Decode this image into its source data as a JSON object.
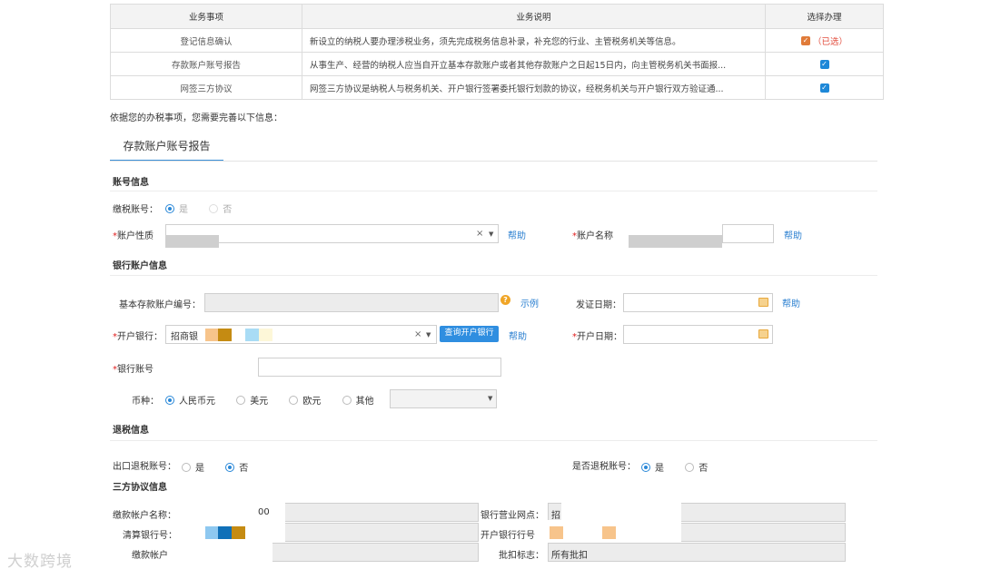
{
  "business_table": {
    "headers": [
      "业务事项",
      "业务说明",
      "选择办理"
    ],
    "rows": [
      {
        "item": "登记信息确认",
        "desc": "新设立的纳税人要办理涉税业务，须先完成税务信息补录，补充您的行业、主管税务机关等信息。",
        "selected_label": "（已选）"
      },
      {
        "item": "存款账户账号报告",
        "desc": "从事生产、经营的纳税人应当自开立基本存款账户或者其他存款账户之日起15日内，向主管税务机关书面报..."
      },
      {
        "item": "网签三方协议",
        "desc": "网签三方协议是纳税人与税务机关、开户银行签署委托银行划款的协议，经税务机关与开户银行双方验证通..."
      }
    ]
  },
  "intro_text": "依据您的办税事项，您需要完善以下信息：",
  "tab": {
    "label": "存款账户账号报告"
  },
  "sections": {
    "account_info": "账号信息",
    "bank_info": "银行账户信息",
    "refund_info": "退税信息",
    "tripartite_info": "三方协议信息"
  },
  "form": {
    "tax_account_label": "缴税账号：",
    "yes": "是",
    "no": "否",
    "account_nature_label": "账户性质",
    "account_name_label": "账户名称",
    "help": "帮助",
    "basic_deposit_label": "基本存款账户编号：",
    "example": "示例",
    "issue_date_label": "发证日期：",
    "opening_bank_label": "开户银行：",
    "opening_bank_value": "招商银",
    "query_bank_button": "查询开户银行",
    "opening_date_label": "开户日期：",
    "bank_account_label": "银行账号",
    "currency_label": "币种：",
    "currencies": [
      "人民币元",
      "美元",
      "欧元",
      "其他"
    ],
    "export_refund_label": "出口退税账号：",
    "is_refund_label": "是否退税账号：",
    "pay_account_name_label": "缴款帐户名称：",
    "pay_account_name_value": "00",
    "bank_branch_label": "银行营业网点：",
    "bank_branch_value": "招",
    "clearing_bank_label": "清算银行号：",
    "opening_bank_no_label": "开户银行行号",
    "pay_account_label": "缴款帐户",
    "deduct_flag_label": "批扣标志：",
    "deduct_flag_value": "所有批扣"
  },
  "watermark": "大数跨境",
  "colors": {
    "accent": "#2f8ee0",
    "selected": "#e24b3b",
    "orange_check": "#e07b39"
  }
}
